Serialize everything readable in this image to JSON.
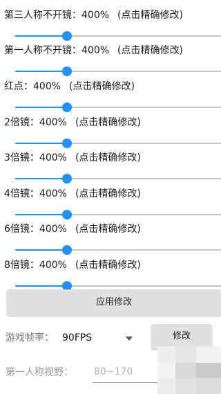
{
  "settings": [
    {
      "label": "第三人称不开镜：400%",
      "hint": "(点击精确修改)",
      "value_percent": 25
    },
    {
      "label": "第一人称不开镜：400%",
      "hint": "(点击精确修改)",
      "value_percent": 25
    },
    {
      "label": "红点：400%",
      "hint": "(点击精确修改)",
      "value_percent": 25
    },
    {
      "label": "2倍镜：400%",
      "hint": "(点击精确修改)",
      "value_percent": 25
    },
    {
      "label": "3倍镜：400%",
      "hint": "(点击精确修改)",
      "value_percent": 25
    },
    {
      "label": "4倍镜：400%",
      "hint": "(点击精确修改)",
      "value_percent": 25
    },
    {
      "label": "6倍镜：400%",
      "hint": "(点击精确修改)",
      "value_percent": 25
    },
    {
      "label": "8倍镜：400%",
      "hint": "(点击精确修改)",
      "value_percent": 25
    }
  ],
  "apply_button": {
    "label": "应用修改"
  },
  "fps": {
    "label": "游戏帧率：",
    "value": "90FPS",
    "caret_icon": "dropdown-triangle-icon"
  },
  "modify_button": {
    "label": "修改"
  },
  "fov": {
    "label": "第一人称视野：",
    "placeholder": "80~170",
    "value": ""
  },
  "colors": {
    "accent": "#1e90ff",
    "track": "#c8c8c8",
    "button": "#e0e0e0"
  }
}
